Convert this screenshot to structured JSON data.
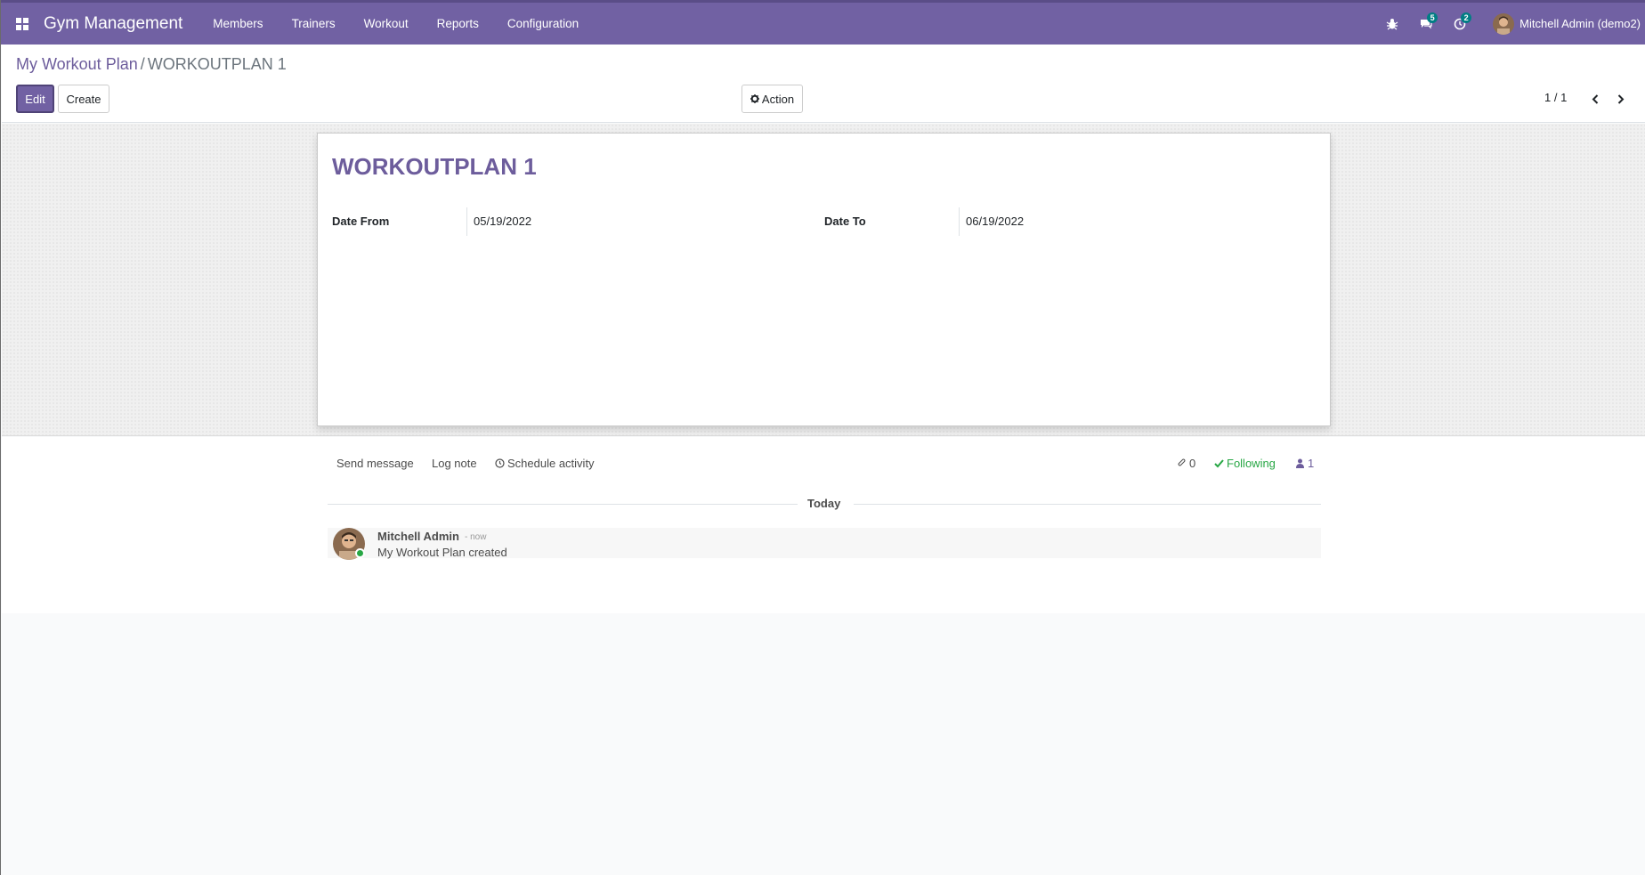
{
  "navbar": {
    "brand": "Gym Management",
    "menu": [
      "Members",
      "Trainers",
      "Workout",
      "Reports",
      "Configuration"
    ],
    "messages_count": "5",
    "activities_count": "2",
    "user_name": "Mitchell Admin (demo2)"
  },
  "breadcrumb": {
    "parent": "My Workout Plan",
    "separator": "/",
    "current": "WORKOUTPLAN 1"
  },
  "buttons": {
    "edit": "Edit",
    "create": "Create",
    "action": "Action"
  },
  "pager": {
    "value": "1 / 1"
  },
  "record": {
    "title": "WORKOUTPLAN 1",
    "date_from_label": "Date From",
    "date_from": "05/19/2022",
    "date_to_label": "Date To",
    "date_to": "06/19/2022"
  },
  "chatter": {
    "send_message": "Send message",
    "log_note": "Log note",
    "schedule_activity": "Schedule activity",
    "attachments": "0",
    "following": "Following",
    "followers": "1",
    "date_separator": "Today",
    "message": {
      "author": "Mitchell Admin",
      "time": "- now",
      "body": "My Workout Plan created"
    }
  },
  "colors": {
    "brand": "#7161a3",
    "accent_text": "#6d5d9c",
    "badge": "#017e84",
    "following": "#28a745"
  }
}
